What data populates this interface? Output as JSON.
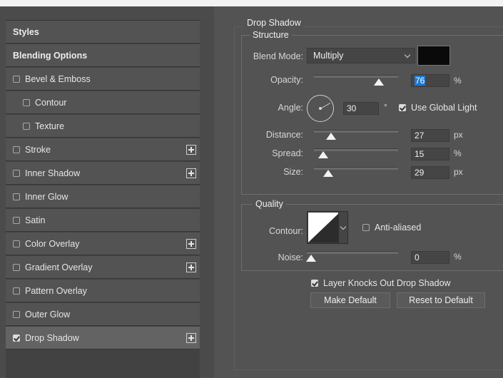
{
  "styles_panel": {
    "items": [
      {
        "label": "Styles",
        "type": "header"
      },
      {
        "label": "Blending Options",
        "type": "header"
      },
      {
        "label": "Bevel & Emboss",
        "checked": false,
        "plus": false,
        "indent": 0
      },
      {
        "label": "Contour",
        "checked": false,
        "plus": false,
        "indent": 1
      },
      {
        "label": "Texture",
        "checked": false,
        "plus": false,
        "indent": 1
      },
      {
        "label": "Stroke",
        "checked": false,
        "plus": true,
        "indent": 0
      },
      {
        "label": "Inner Shadow",
        "checked": false,
        "plus": true,
        "indent": 0
      },
      {
        "label": "Inner Glow",
        "checked": false,
        "plus": false,
        "indent": 0
      },
      {
        "label": "Satin",
        "checked": false,
        "plus": false,
        "indent": 0
      },
      {
        "label": "Color Overlay",
        "checked": false,
        "plus": true,
        "indent": 0
      },
      {
        "label": "Gradient Overlay",
        "checked": false,
        "plus": true,
        "indent": 0
      },
      {
        "label": "Pattern Overlay",
        "checked": false,
        "plus": false,
        "indent": 0
      },
      {
        "label": "Outer Glow",
        "checked": false,
        "plus": false,
        "indent": 0
      },
      {
        "label": "Drop Shadow",
        "checked": true,
        "plus": true,
        "indent": 0,
        "active": true
      }
    ]
  },
  "drop_shadow": {
    "title": "Drop Shadow",
    "structure": {
      "legend": "Structure",
      "blend_mode_label": "Blend Mode:",
      "blend_mode_value": "Multiply",
      "shadow_color": "#0a0a0a",
      "opacity_label": "Opacity:",
      "opacity_value": "76",
      "opacity_unit": "%",
      "opacity_level": 0.76,
      "angle_label": "Angle:",
      "angle_value": "30",
      "angle_unit": "°",
      "use_global_light_label": "Use Global Light",
      "use_global_light": true,
      "distance_label": "Distance:",
      "distance_value": "27",
      "distance_unit": "px",
      "spread_label": "Spread:",
      "spread_value": "15",
      "spread_unit": "%",
      "size_label": "Size:",
      "size_value": "29",
      "size_unit": "px"
    },
    "quality": {
      "legend": "Quality",
      "contour_label": "Contour:",
      "anti_aliased_label": "Anti-aliased",
      "anti_aliased": false,
      "noise_label": "Noise:",
      "noise_value": "0",
      "noise_unit": "%"
    },
    "layer_knocks_out_label": "Layer Knocks Out Drop Shadow",
    "layer_knocks_out": true,
    "make_default_label": "Make Default",
    "reset_default_label": "Reset to Default"
  },
  "icons": {
    "checkbox": "checkbox-icon",
    "plus": "plus-square-icon",
    "chevron": "chevron-down-icon",
    "angle_dial": "angle-dial-icon",
    "slider_thumb": "triangle-thumb-icon"
  }
}
